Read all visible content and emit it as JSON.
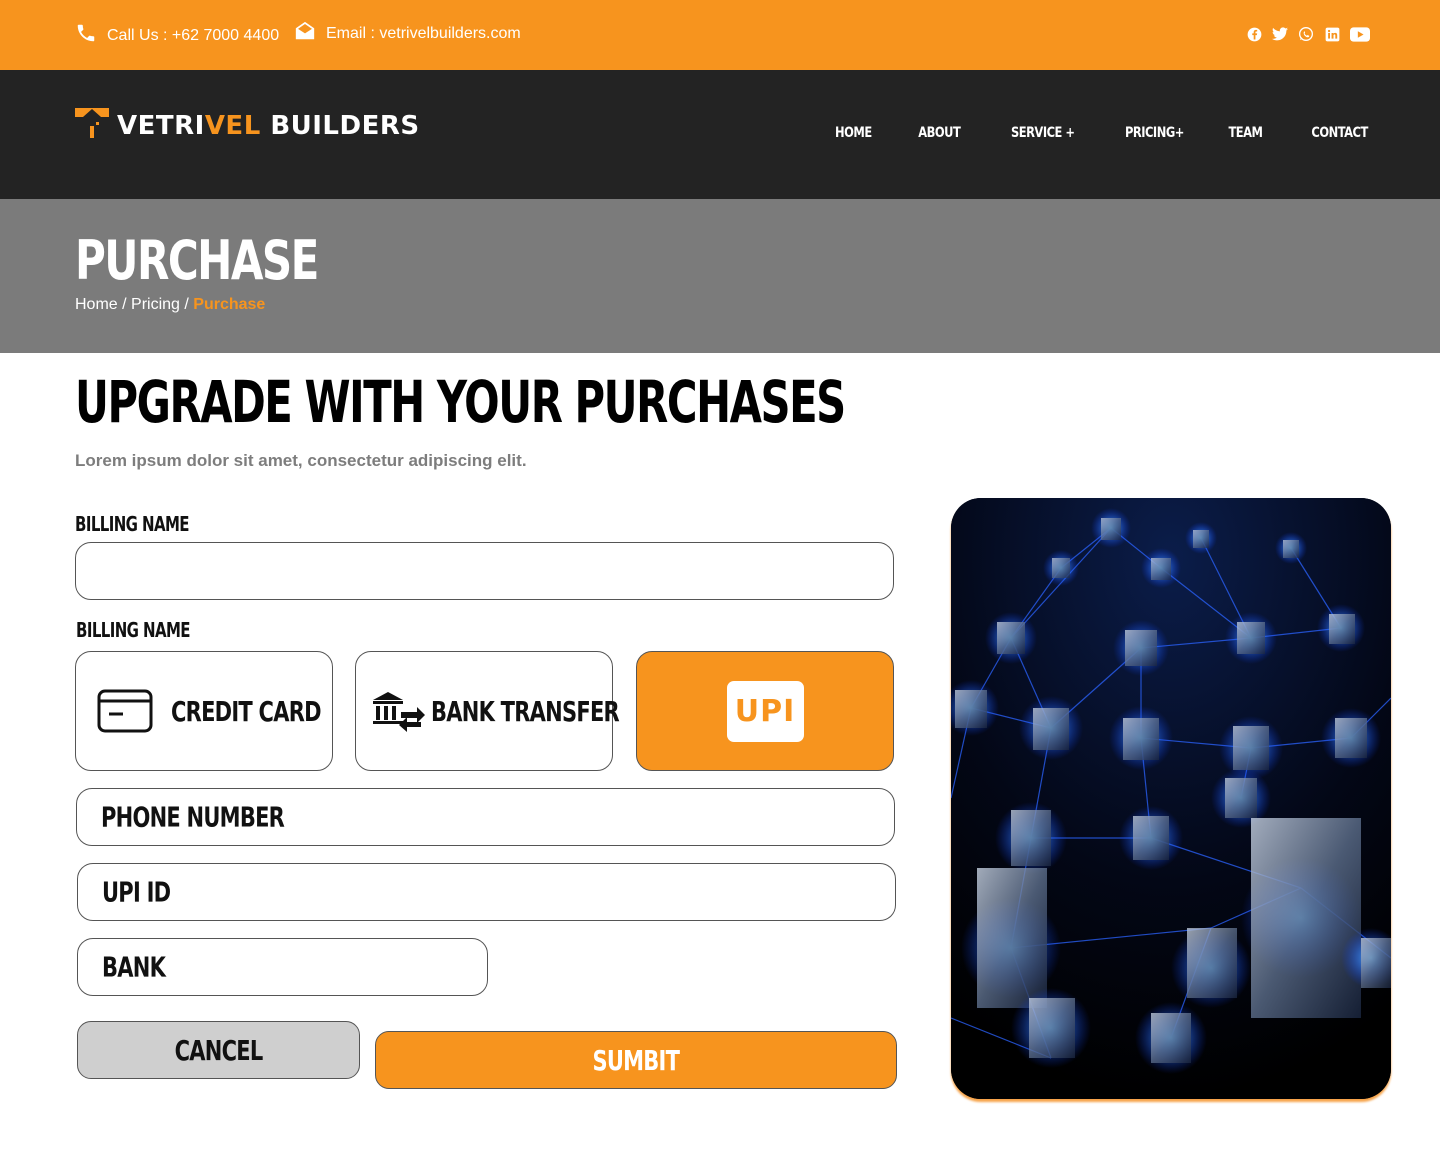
{
  "topbar": {
    "phone_label": "Call Us : +62 7000 4400",
    "email_label": "Email : vetrivelbuilders.com",
    "social_icons": [
      "facebook-icon",
      "twitter-icon",
      "whatsapp-icon",
      "linkedin-icon",
      "youtube-icon"
    ]
  },
  "brand": {
    "part1": "VETRI",
    "part2": "VEL",
    "part3": " BUILDERS",
    "accent_color": "#f7941e"
  },
  "nav": {
    "items": [
      {
        "label": "HOME"
      },
      {
        "label": "ABOUT"
      },
      {
        "label": "SERVICE +"
      },
      {
        "label": "PRICING+"
      },
      {
        "label": "TEAM"
      },
      {
        "label": "CONTACT"
      }
    ]
  },
  "hero": {
    "title": "PURCHASE",
    "breadcrumb": {
      "home": "Home",
      "sep1": " / ",
      "pricing": "Pricing",
      "sep2": " / ",
      "current": "Purchase"
    }
  },
  "main": {
    "title": "UPGRADE WITH YOUR PURCHASES",
    "subtitle": "Lorem ipsum dolor sit amet, consectetur adipiscing elit.",
    "billing_label": "BILLING NAME",
    "billing_value": "",
    "payment_label": "BILLING NAME",
    "payment_methods": [
      {
        "label": "CREDIT CARD",
        "icon": "credit-card-icon",
        "selected": false
      },
      {
        "label": "BANK TRANSFER",
        "icon": "bank-transfer-icon",
        "selected": false
      },
      {
        "label": "UPI",
        "icon": "upi-logo",
        "selected": true
      }
    ],
    "phone_placeholder": "PHONE NUMBER",
    "upi_placeholder": "UPI ID",
    "bank_placeholder": "BANK",
    "cancel_label": "CANCEL",
    "submit_label": "SUMBIT"
  }
}
